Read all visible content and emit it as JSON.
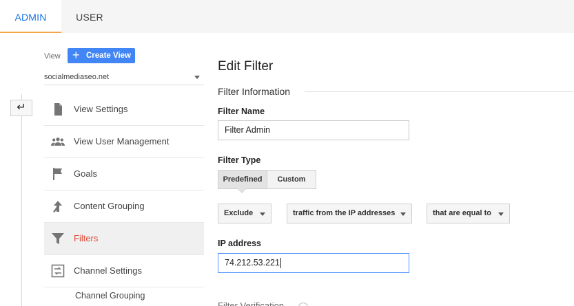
{
  "tabs": [
    {
      "label": "ADMIN",
      "active": true
    },
    {
      "label": "USER",
      "active": false
    }
  ],
  "back_icon": "arrow-left-return-icon",
  "view": {
    "label": "View",
    "create_button": "Create View",
    "selected": "socialmediaseo.net"
  },
  "nav": [
    {
      "label": "View Settings",
      "icon": "document-icon"
    },
    {
      "label": "View User Management",
      "icon": "people-icon"
    },
    {
      "label": "Goals",
      "icon": "flag-icon"
    },
    {
      "label": "Content Grouping",
      "icon": "content-grouping-icon"
    },
    {
      "label": "Filters",
      "icon": "filter-icon",
      "active": true
    },
    {
      "label": "Channel Settings",
      "icon": "channel-settings-icon"
    }
  ],
  "nav_sub": "Channel Grouping",
  "main": {
    "title": "Edit Filter",
    "section": "Filter Information",
    "filter_name_label": "Filter Name",
    "filter_name_value": "Filter Admin",
    "filter_type_label": "Filter Type",
    "type_options": [
      "Predefined",
      "Custom"
    ],
    "type_selected": "Predefined",
    "dropdowns": [
      "Exclude",
      "traffic from the IP addresses",
      "that are equal to"
    ],
    "ip_label": "IP address",
    "ip_value": "74.212.53.221",
    "partial_section": "Filter Verification"
  },
  "colors": {
    "accent_blue": "#4285f4",
    "tab_active_text": "#1a73e8",
    "tab_underline": "#f4a74a",
    "active_nav_text": "#dd4b39"
  }
}
